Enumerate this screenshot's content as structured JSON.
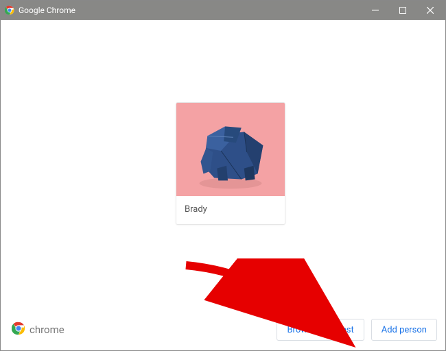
{
  "window": {
    "title": "Google Chrome"
  },
  "profile": {
    "name": "Brady",
    "avatar_bg": "#f4a2a4",
    "avatar_desc": "origami-elephant"
  },
  "footer": {
    "brand": "chrome",
    "browse_guest": "Browse as Guest",
    "add_person": "Add person"
  },
  "colors": {
    "accent": "#1a73e8",
    "titlebar": "#888886"
  }
}
